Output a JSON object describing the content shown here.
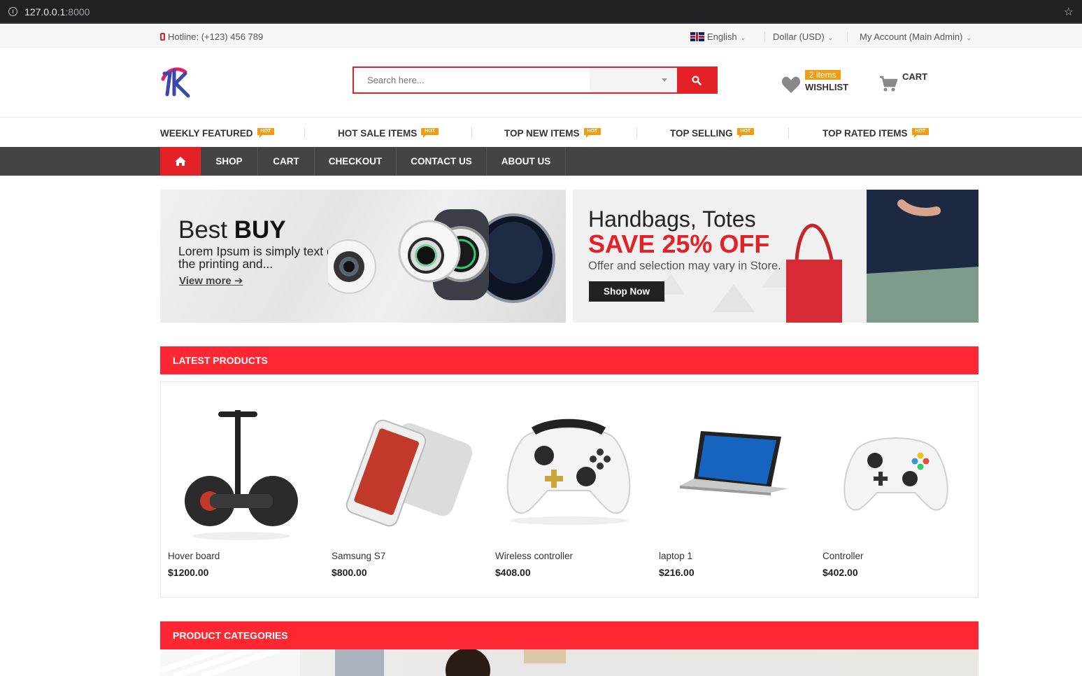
{
  "browser": {
    "url_host": "127.0.0.1",
    "url_port": ":8000"
  },
  "topbar": {
    "hotline": "Hotline: (+123) 456 789",
    "language": "English",
    "currency": "Dollar (USD)",
    "account": "My Account (Main Admin)"
  },
  "header": {
    "search_placeholder": "Search here...",
    "wishlist_count": "2 items",
    "wishlist_label": "WISHLIST",
    "cart_label": "CART"
  },
  "hot_nav": {
    "badge": "HOT",
    "items": [
      "WEEKLY FEATURED",
      "HOT SALE ITEMS",
      "TOP NEW ITEMS",
      "TOP SELLING",
      "TOP RATED ITEMS"
    ]
  },
  "main_nav": {
    "items": [
      "SHOP",
      "CART",
      "CHECKOUT",
      "CONTACT US",
      "ABOUT US"
    ]
  },
  "banner1": {
    "title_light": "Best ",
    "title_bold": "BUY",
    "text": "Lorem Ipsum is simply text of the printing and...",
    "link": "View more"
  },
  "banner2": {
    "title": "Handbags, Totes",
    "sale": "SAVE 25% OFF",
    "text": "Offer and selection may vary in Store.",
    "button": "Shop Now"
  },
  "latest": {
    "heading": "LATEST PRODUCTS",
    "products": [
      {
        "name": "Hover board",
        "price": "$1200.00"
      },
      {
        "name": "Samsung S7",
        "price": "$800.00"
      },
      {
        "name": "Wireless controller",
        "price": "$408.00"
      },
      {
        "name": "laptop 1",
        "price": "$216.00"
      },
      {
        "name": "Controller",
        "price": "$402.00"
      }
    ]
  },
  "categories": {
    "heading": "PRODUCT CATEGORIES"
  },
  "colors": {
    "accent": "#ff2832",
    "hot_badge": "#f39c12",
    "nav_bg": "#444444"
  }
}
